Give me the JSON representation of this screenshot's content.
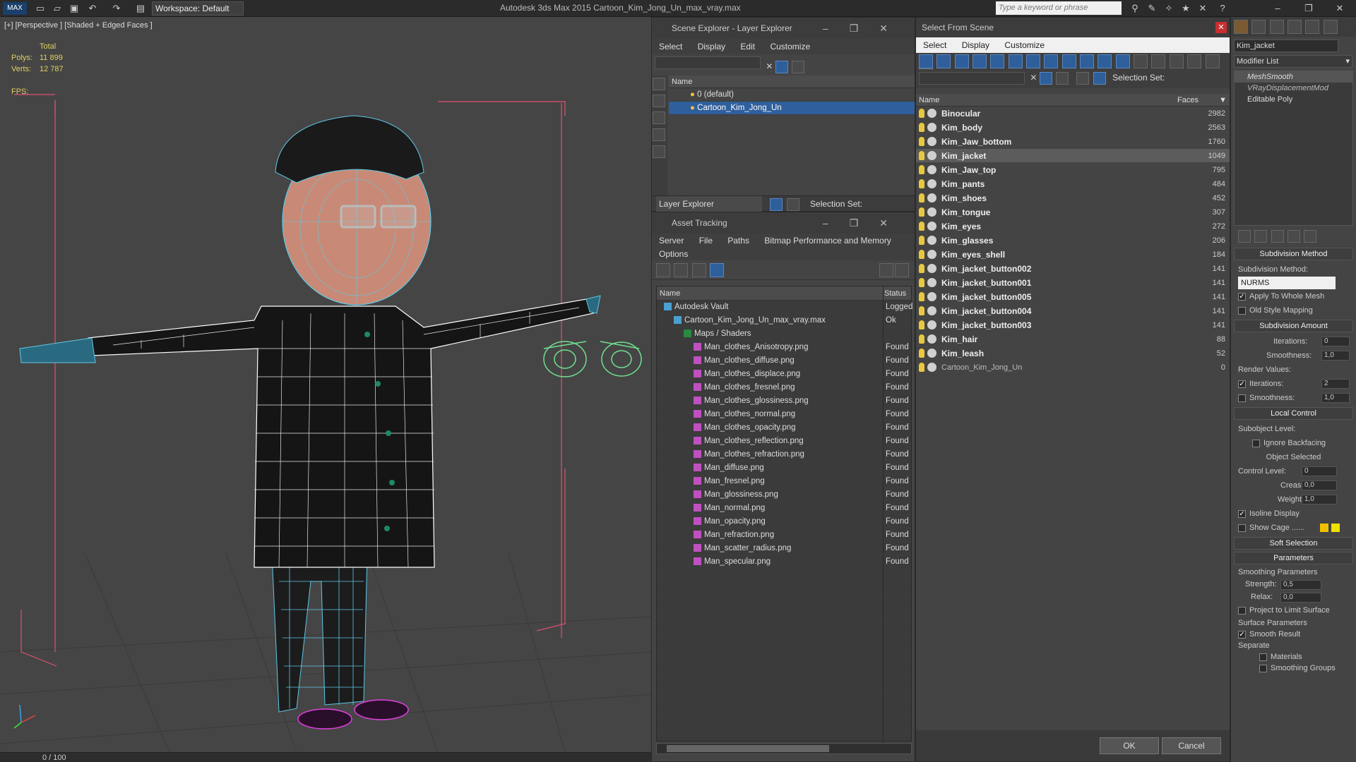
{
  "titlebar": {
    "workspace": "Workspace: Default",
    "title": "Autodesk 3ds Max  2015    Cartoon_Kim_Jong_Un_max_vray.max",
    "search_placeholder": "Type a keyword or phrase"
  },
  "viewport": {
    "label": "[+] [Perspective ] [Shaded + Edged Faces ]",
    "total_label": "Total",
    "polys_label": "Polys:",
    "polys_value": "11 899",
    "verts_label": "Verts:",
    "verts_value": "12 787",
    "fps_label": "FPS:"
  },
  "timeline": {
    "frame": "0 / 100"
  },
  "scene_explorer": {
    "title": "Scene Explorer - Layer Explorer",
    "menu": [
      "Select",
      "Display",
      "Edit",
      "Customize"
    ],
    "column_name": "Name",
    "layers": [
      "0 (default)",
      "Cartoon_Kim_Jong_Un"
    ],
    "footer_label": "Layer Explorer",
    "selection_set": "Selection Set:"
  },
  "asset_tracking": {
    "title": "Asset Tracking",
    "menu": [
      "Server",
      "File",
      "Paths",
      "Bitmap Performance and Memory"
    ],
    "menu2": "Options",
    "col_name": "Name",
    "col_status": "Status",
    "rows": [
      {
        "name": "Autodesk Vault",
        "status": "Logged",
        "indent": 0
      },
      {
        "name": "Cartoon_Kim_Jong_Un_max_vray.max",
        "status": "Ok",
        "indent": 1
      },
      {
        "name": "Maps / Shaders",
        "status": "",
        "indent": 2
      },
      {
        "name": "Man_clothes_Anisotropy.png",
        "status": "Found",
        "indent": 3
      },
      {
        "name": "Man_clothes_diffuse.png",
        "status": "Found",
        "indent": 3
      },
      {
        "name": "Man_clothes_displace.png",
        "status": "Found",
        "indent": 3
      },
      {
        "name": "Man_clothes_fresnel.png",
        "status": "Found",
        "indent": 3
      },
      {
        "name": "Man_clothes_glossiness.png",
        "status": "Found",
        "indent": 3
      },
      {
        "name": "Man_clothes_normal.png",
        "status": "Found",
        "indent": 3
      },
      {
        "name": "Man_clothes_opacity.png",
        "status": "Found",
        "indent": 3
      },
      {
        "name": "Man_clothes_reflection.png",
        "status": "Found",
        "indent": 3
      },
      {
        "name": "Man_clothes_refraction.png",
        "status": "Found",
        "indent": 3
      },
      {
        "name": "Man_diffuse.png",
        "status": "Found",
        "indent": 3
      },
      {
        "name": "Man_fresnel.png",
        "status": "Found",
        "indent": 3
      },
      {
        "name": "Man_glossiness.png",
        "status": "Found",
        "indent": 3
      },
      {
        "name": "Man_normal.png",
        "status": "Found",
        "indent": 3
      },
      {
        "name": "Man_opacity.png",
        "status": "Found",
        "indent": 3
      },
      {
        "name": "Man_refraction.png",
        "status": "Found",
        "indent": 3
      },
      {
        "name": "Man_scatter_radius.png",
        "status": "Found",
        "indent": 3
      },
      {
        "name": "Man_specular.png",
        "status": "Found",
        "indent": 3
      }
    ]
  },
  "select_from_scene": {
    "title": "Select From Scene",
    "menu": [
      "Select",
      "Display",
      "Customize"
    ],
    "selection_set": "Selection Set:",
    "col_name": "Name",
    "col_faces": "Faces",
    "rows": [
      {
        "name": "Binocular",
        "faces": "2982"
      },
      {
        "name": "Kim_body",
        "faces": "2563"
      },
      {
        "name": "Kim_Jaw_bottom",
        "faces": "1760"
      },
      {
        "name": "Kim_jacket",
        "faces": "1049"
      },
      {
        "name": "Kim_Jaw_top",
        "faces": "795"
      },
      {
        "name": "Kim_pants",
        "faces": "484"
      },
      {
        "name": "Kim_shoes",
        "faces": "452"
      },
      {
        "name": "Kim_tongue",
        "faces": "307"
      },
      {
        "name": "Kim_eyes",
        "faces": "272"
      },
      {
        "name": "Kim_glasses",
        "faces": "206"
      },
      {
        "name": "Kim_eyes_shell",
        "faces": "184"
      },
      {
        "name": "Kim_jacket_button002",
        "faces": "141"
      },
      {
        "name": "Kim_jacket_button001",
        "faces": "141"
      },
      {
        "name": "Kim_jacket_button005",
        "faces": "141"
      },
      {
        "name": "Kim_jacket_button004",
        "faces": "141"
      },
      {
        "name": "Kim_jacket_button003",
        "faces": "141"
      },
      {
        "name": "Kim_hair",
        "faces": "88"
      },
      {
        "name": "Kim_leash",
        "faces": "52"
      },
      {
        "name": "Cartoon_Kim_Jong_Un",
        "faces": "0"
      }
    ],
    "ok": "OK",
    "cancel": "Cancel"
  },
  "command_panel": {
    "object_name": "Kim_jacket",
    "modifier_list": "Modifier List",
    "stack": [
      "MeshSmooth",
      "VRayDisplacementMod",
      "Editable Poly"
    ],
    "subdivision_method_title": "Subdivision Method",
    "subdivision_method_label": "Subdivision Method:",
    "subdivision_method_value": "NURMS",
    "apply_whole_mesh": "Apply To Whole Mesh",
    "old_style_mapping": "Old Style Mapping",
    "subdivision_amount_title": "Subdivision Amount",
    "iterations_label": "Iterations:",
    "iterations_value": "0",
    "smoothness_label": "Smoothness:",
    "smoothness_value": "1,0",
    "render_values": "Render Values:",
    "render_iterations_value": "2",
    "render_smoothness_value": "1,0",
    "local_control_title": "Local Control",
    "subobject_level": "Subobject Level:",
    "ignore_backfacing": "Ignore Backfacing",
    "object_selected": "Object Selected",
    "control_level_label": "Control Level:",
    "control_level_value": "0",
    "crease_label": "Crease:",
    "crease_value": "0,0",
    "weight_label": "Weight:",
    "weight_value": "1,0",
    "isoline_display": "Isoline Display",
    "show_cage": "Show Cage ......",
    "soft_selection_title": "Soft Selection",
    "parameters_title": "Parameters",
    "smoothing_parameters": "Smoothing Parameters",
    "strength_label": "Strength:",
    "strength_value": "0,5",
    "relax_label": "Relax:",
    "relax_value": "0,0",
    "project_limit": "Project to Limit Surface",
    "surface_parameters": "Surface Parameters",
    "smooth_result": "Smooth Result",
    "separate": "Separate",
    "materials": "Materials",
    "smoothing_groups": "Smoothing Groups"
  }
}
